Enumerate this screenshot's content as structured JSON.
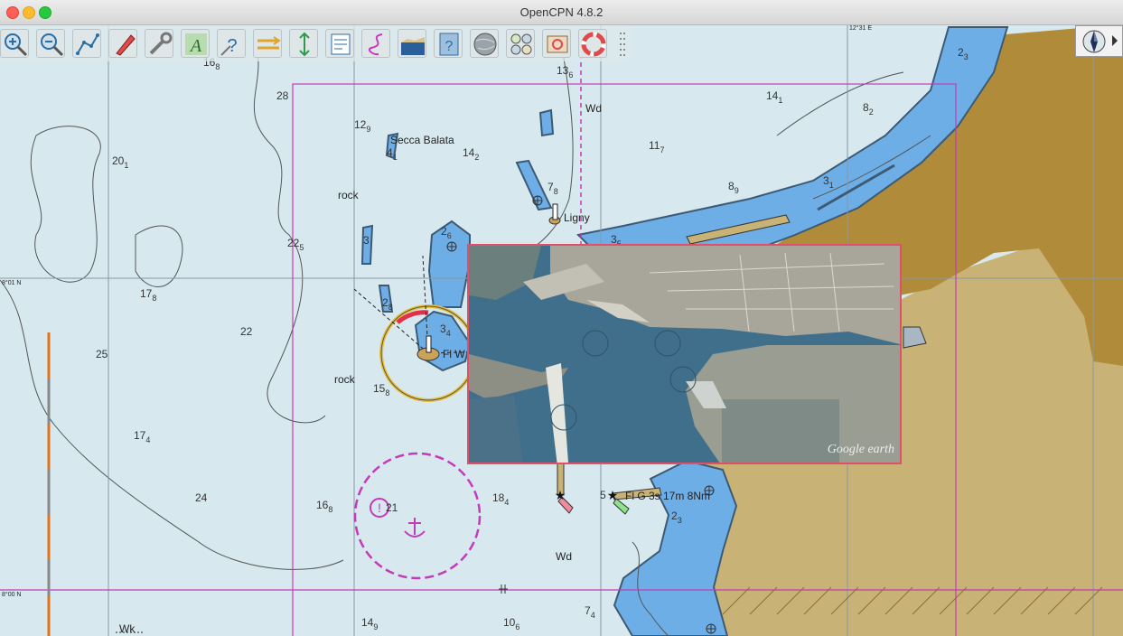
{
  "window": {
    "title": "OpenCPN 4.8.2"
  },
  "toolbar": {
    "buttons": [
      {
        "name": "zoom-in",
        "icon": "zoom-in-icon"
      },
      {
        "name": "zoom-out",
        "icon": "zoom-out-icon"
      },
      {
        "name": "route",
        "icon": "route-icon"
      },
      {
        "name": "ship",
        "icon": "ship-icon"
      },
      {
        "name": "settings",
        "icon": "wrench-icon"
      },
      {
        "name": "text",
        "icon": "text-icon"
      },
      {
        "name": "query",
        "icon": "query-icon"
      },
      {
        "name": "route-manager",
        "icon": "route-manager-icon"
      },
      {
        "name": "tide",
        "icon": "tide-icon"
      },
      {
        "name": "print",
        "icon": "print-icon"
      },
      {
        "name": "track",
        "icon": "track-icon"
      },
      {
        "name": "ais",
        "icon": "ais-icon"
      },
      {
        "name": "help",
        "icon": "help-icon"
      },
      {
        "name": "globe",
        "icon": "globe-icon"
      },
      {
        "name": "dashboard",
        "icon": "dashboard-icon"
      },
      {
        "name": "chart-downloader",
        "icon": "chart-downloader-icon"
      },
      {
        "name": "mob",
        "icon": "lifebuoy-icon"
      }
    ]
  },
  "chart": {
    "labels": {
      "secca_balata": "Secca Balata",
      "rock1": "rock",
      "rock2": "rock",
      "ligny": "Ligny",
      "wd1": "Wd",
      "wd2": "Wd",
      "fl_w": "Fl W",
      "fl_g": "Fl G 3s 17m 8Nm",
      "wk": "Wk",
      "lat1": "8°01 N",
      "lat2": "8°00 N",
      "lon1": "12°31 E"
    },
    "soundings": [
      {
        "a": "13",
        "b": "6"
      },
      {
        "a": "14",
        "b": "1"
      },
      {
        "a": "8",
        "b": "2"
      },
      {
        "a": "11",
        "b": "7"
      },
      {
        "a": "14",
        "b": "2"
      },
      {
        "a": "12",
        "b": "9"
      },
      {
        "a": "20",
        "b": "1"
      },
      {
        "a": "7",
        "b": "8"
      },
      {
        "a": "8",
        "b": "9"
      },
      {
        "a": "3",
        "b": "1"
      },
      {
        "a": "2",
        "b": "3"
      },
      {
        "a": "2",
        "b": "6"
      },
      {
        "a": "22",
        "b": "5"
      },
      {
        "a": "17",
        "b": "8"
      },
      {
        "a": "2",
        "b": "8"
      },
      {
        "a": "3",
        "b": "4"
      },
      {
        "a": "15",
        "b": "8"
      },
      {
        "a": "17",
        "b": "4"
      },
      {
        "a": "16",
        "b": "8"
      },
      {
        "a": "18",
        "b": "4"
      },
      {
        "a": "2",
        "b": "3"
      },
      {
        "a": "14",
        "b": "9"
      },
      {
        "a": "10",
        "b": "6"
      },
      {
        "a": "7",
        "b": "4"
      },
      {
        "a": "3",
        "b": "5"
      },
      {
        "a": "4",
        "b": "1"
      },
      {
        "a": "16",
        "b": "8"
      }
    ],
    "plain_depths": [
      "28",
      "25",
      "22",
      "24",
      "21",
      "3",
      "5"
    ]
  },
  "overlay": {
    "attribution": "Google earth"
  },
  "colors": {
    "deep_water": "#d7e9ef",
    "shallow_water": "#6eaee6",
    "land_dark": "#b08c3a",
    "land_light": "#c9b276",
    "magenta": "#c43ab8"
  }
}
